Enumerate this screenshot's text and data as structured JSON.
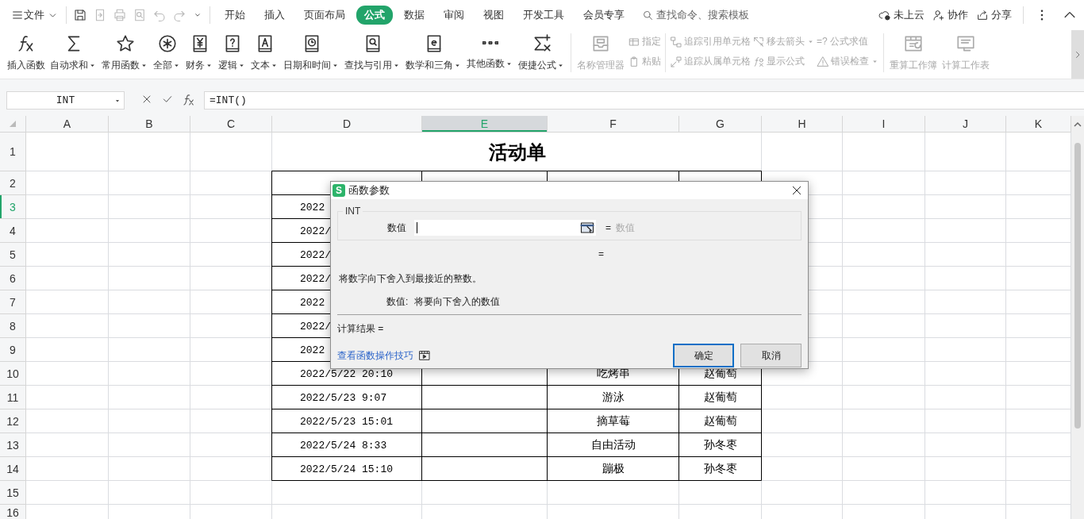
{
  "topbar": {
    "file_menu": "文件",
    "quick_access": [
      {
        "kind": "save",
        "disabled": false
      },
      {
        "kind": "export",
        "disabled": true
      },
      {
        "kind": "print",
        "disabled": true
      },
      {
        "kind": "preview",
        "disabled": true
      },
      {
        "kind": "undo",
        "disabled": true
      },
      {
        "kind": "redo",
        "disabled": true
      },
      {
        "kind": "more",
        "disabled": false
      }
    ],
    "tabs": [
      {
        "label": "开始",
        "selected": false
      },
      {
        "label": "插入",
        "selected": false
      },
      {
        "label": "页面布局",
        "selected": false
      },
      {
        "label": "公式",
        "selected": true
      },
      {
        "label": "数据",
        "selected": false
      },
      {
        "label": "审阅",
        "selected": false
      },
      {
        "label": "视图",
        "selected": false
      },
      {
        "label": "开发工具",
        "selected": false
      },
      {
        "label": "会员专享",
        "selected": false
      }
    ],
    "search": {
      "placeholder": "查找命令、搜索模板"
    },
    "actions": [
      {
        "kind": "cloud",
        "label": "未上云"
      },
      {
        "kind": "collab",
        "label": "协作"
      },
      {
        "kind": "share",
        "label": "分享"
      }
    ]
  },
  "ribbon": {
    "groups": [
      {
        "kind": "large",
        "items": [
          {
            "label": "插入函数",
            "dropdown": false,
            "disabled": false
          },
          {
            "label": "自动求和",
            "dropdown": true,
            "disabled": false
          },
          {
            "label": "常用函数",
            "dropdown": true,
            "disabled": false
          },
          {
            "label": "全部",
            "dropdown": true,
            "disabled": false
          },
          {
            "label": "财务",
            "dropdown": true,
            "disabled": false
          },
          {
            "label": "逻辑",
            "dropdown": true,
            "disabled": false
          },
          {
            "label": "文本",
            "dropdown": true,
            "disabled": false
          },
          {
            "label": "日期和时间",
            "dropdown": true,
            "disabled": false
          },
          {
            "label": "查找与引用",
            "dropdown": true,
            "disabled": false
          },
          {
            "label": "数学和三角",
            "dropdown": true,
            "disabled": false
          },
          {
            "label": "其他函数",
            "dropdown": true,
            "disabled": false
          },
          {
            "label": "便捷公式",
            "dropdown": true,
            "disabled": false
          }
        ]
      },
      {
        "kind": "large",
        "items": [
          {
            "label": "名称管理器",
            "dropdown": false,
            "disabled": true
          }
        ]
      },
      {
        "kind": "stack",
        "items": [
          {
            "label": "指定",
            "dropdown": false,
            "disabled": true
          },
          {
            "label": "粘贴",
            "dropdown": false,
            "disabled": true
          }
        ]
      },
      {
        "kind": "stack",
        "items": [
          {
            "label": "追踪引用单元格",
            "dropdown": false,
            "disabled": true
          },
          {
            "label": "追踪从属单元格",
            "dropdown": false,
            "disabled": true
          }
        ]
      },
      {
        "kind": "stack",
        "items": [
          {
            "label": "移去箭头",
            "dropdown": true,
            "disabled": true
          },
          {
            "label": "显示公式",
            "dropdown": false,
            "disabled": true
          }
        ]
      },
      {
        "kind": "stack",
        "items": [
          {
            "label": "=? 公式求值",
            "dropdown": false,
            "disabled": true
          },
          {
            "label": "错误检查",
            "dropdown": true,
            "disabled": true
          }
        ]
      },
      {
        "kind": "large",
        "items": [
          {
            "label": "重算工作簿",
            "dropdown": false,
            "disabled": true
          },
          {
            "label": "计算工作表",
            "dropdown": false,
            "disabled": true
          }
        ]
      }
    ]
  },
  "formula_bar": {
    "name_box": "INT",
    "formula": "=INT()"
  },
  "sheet": {
    "columns": [
      {
        "label": "A",
        "selected": false
      },
      {
        "label": "B",
        "selected": false
      },
      {
        "label": "C",
        "selected": false
      },
      {
        "label": "D",
        "selected": false
      },
      {
        "label": "E",
        "selected": true
      },
      {
        "label": "F",
        "selected": false
      },
      {
        "label": "G",
        "selected": false
      },
      {
        "label": "H",
        "selected": false
      },
      {
        "label": "I",
        "selected": false
      },
      {
        "label": "J",
        "selected": false
      },
      {
        "label": "K",
        "selected": false
      }
    ],
    "rows": [
      {
        "label": "1",
        "selected": false
      },
      {
        "label": "2",
        "selected": false
      },
      {
        "label": "3",
        "selected": true
      },
      {
        "label": "4",
        "selected": false
      },
      {
        "label": "5",
        "selected": false
      },
      {
        "label": "6",
        "selected": false
      },
      {
        "label": "7",
        "selected": false
      },
      {
        "label": "8",
        "selected": false
      },
      {
        "label": "9",
        "selected": false
      },
      {
        "label": "10",
        "selected": false
      },
      {
        "label": "11",
        "selected": false
      },
      {
        "label": "12",
        "selected": false
      },
      {
        "label": "13",
        "selected": false
      },
      {
        "label": "14",
        "selected": false
      },
      {
        "label": "15",
        "selected": false
      },
      {
        "label": "16",
        "selected": false
      }
    ],
    "title": "活动单",
    "records": [
      {
        "time": "2022"
      },
      {
        "time": "2022/"
      },
      {
        "time": "2022/"
      },
      {
        "time": "2022/"
      },
      {
        "time": "2022"
      },
      {
        "time": "2022/"
      },
      {
        "time": "2022"
      },
      {
        "time": "2022/5/22 20:10",
        "activity": "吃烤串",
        "person": "赵葡萄"
      },
      {
        "time": "2022/5/23 9:07",
        "activity": "游泳",
        "person": "赵葡萄"
      },
      {
        "time": "2022/5/23 15:01",
        "activity": "摘草莓",
        "person": "赵葡萄"
      },
      {
        "time": "2022/5/24 8:33",
        "activity": "自由活动",
        "person": "孙冬枣"
      },
      {
        "time": "2022/5/24 15:10",
        "activity": "蹦极",
        "person": "孙冬枣"
      }
    ]
  },
  "dialog": {
    "logo": "S",
    "title": "函数参数",
    "function_name": "INT",
    "args": [
      {
        "label": "数值",
        "focused": true,
        "equals": "=",
        "result": "数值"
      }
    ],
    "formula_result": "=",
    "description": "将数字向下舍入到最接近的整数。",
    "param_help": {
      "label": "数值:",
      "text": "将要向下舍入的数值"
    },
    "calc_result": "计算结果 =",
    "link": "查看函数操作技巧",
    "buttons": [
      {
        "label": "确定",
        "default": true
      },
      {
        "label": "取消",
        "default": false
      }
    ]
  }
}
